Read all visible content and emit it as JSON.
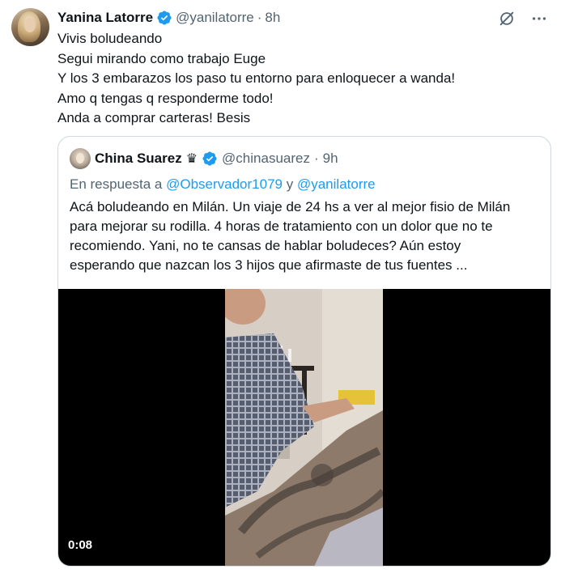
{
  "tweet": {
    "author_name": "Yanina Latorre",
    "author_handle": "@yanilatorre",
    "separator": "·",
    "time": "8h",
    "lines": [
      "Vivis boludeando",
      "Segui mirando como trabajo Euge",
      "Y los 3 embarazos los paso tu entorno para enloquecer a wanda!",
      "Amo q tengas q responderme todo!",
      "Anda a comprar carteras! Besis"
    ]
  },
  "quote": {
    "author_name": "China Suarez",
    "crown": "♛",
    "author_handle": "@chinasuarez",
    "separator": "·",
    "time": "9h",
    "reply_prefix": "En respuesta a",
    "reply_mention_1": "@Observador1079",
    "reply_joiner": "y",
    "reply_mention_2": "@yanilatorre",
    "lines": [
      "Acá boludeando en Milán. Un viaje de 24 hs a ver al mejor fisio de Milán",
      "para mejorar su rodilla. 4 horas de tratamiento con un dolor que no te",
      "recomiendo. Yani, no te cansas de hablar boludeces? Aún estoy",
      "esperando que nazcan los 3 hijos que afirmaste de tus fuentes ..."
    ],
    "video_duration": "0:08"
  },
  "colors": {
    "verified": "#1d9bf0",
    "link": "#1d9bf0",
    "secondary_text": "#536471",
    "border": "#cfd9de"
  },
  "icons": {
    "grok": "grok-slash-circle-icon",
    "more": "more-dots-icon",
    "verified": "verified-badge-icon"
  }
}
